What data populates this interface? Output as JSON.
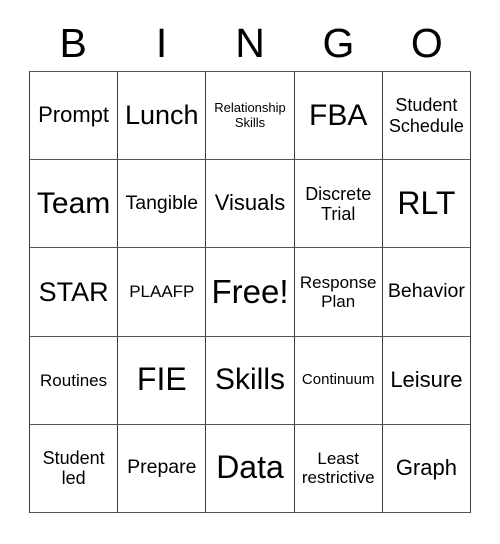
{
  "card": {
    "type": "bingo-card",
    "header_letters": [
      "B",
      "I",
      "N",
      "G",
      "O"
    ],
    "grid_size": "5x5",
    "free_space": "Free!",
    "background_color": "#ffffff",
    "border_color": "#3b3b3b",
    "text_color": "#000000",
    "cells": [
      [
        {
          "label": "Prompt",
          "size": "xl"
        },
        {
          "label": "Lunch",
          "size": "xxl"
        },
        {
          "label": "Relationship\nSkills",
          "size": "xs"
        },
        {
          "label": "FBA",
          "size": "h1"
        },
        {
          "label": "Student\nSchedule",
          "size": "ml"
        }
      ],
      [
        {
          "label": "Team",
          "size": "h1"
        },
        {
          "label": "Tangible",
          "size": "l"
        },
        {
          "label": "Visuals",
          "size": "xl"
        },
        {
          "label": "Discrete\nTrial",
          "size": "ml"
        },
        {
          "label": "RLT",
          "size": "h2"
        }
      ],
      [
        {
          "label": "STAR",
          "size": "xxl"
        },
        {
          "label": "PLAAFP",
          "size": "m"
        },
        {
          "label": "Free!",
          "size": "h3"
        },
        {
          "label": "Response\nPlan",
          "size": "m"
        },
        {
          "label": "Behavior",
          "size": "l"
        }
      ],
      [
        {
          "label": "Routines",
          "size": "m"
        },
        {
          "label": "FIE",
          "size": "h2"
        },
        {
          "label": "Skills",
          "size": "h1"
        },
        {
          "label": "Continuum",
          "size": "s"
        },
        {
          "label": "Leisure",
          "size": "xl"
        }
      ],
      [
        {
          "label": "Student\nled",
          "size": "ml"
        },
        {
          "label": "Prepare",
          "size": "l"
        },
        {
          "label": "Data",
          "size": "h2"
        },
        {
          "label": "Least\nrestrictive",
          "size": "m"
        },
        {
          "label": "Graph",
          "size": "xl"
        }
      ]
    ]
  }
}
